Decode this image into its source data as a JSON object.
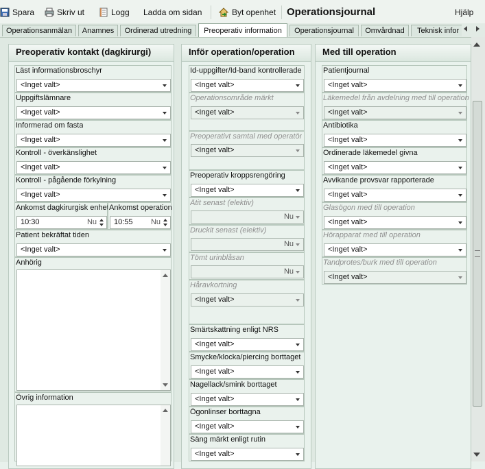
{
  "toolbar": {
    "save": "Spara",
    "print": "Skriv ut",
    "log": "Logg",
    "reload": "Ladda om sidan",
    "change_unit": "Byt openhet",
    "title": "Operationsjournal",
    "help": "Hjälp"
  },
  "tabs": [
    {
      "label": "Operationsanmälan"
    },
    {
      "label": "Anamnes"
    },
    {
      "label": "Ordinerad utredning"
    },
    {
      "label": "Preoperativ information",
      "active": true
    },
    {
      "label": "Operationsjournal"
    },
    {
      "label": "Omvårdnad"
    },
    {
      "label": "Teknisk infor"
    }
  ],
  "default_value": "<Inget valt>",
  "nu_label": "Nu",
  "panel1": {
    "header": "Preoperativ kontakt (dagkirurgi)",
    "fields": {
      "brochure": "Läst informationsbroschyr",
      "informant": "Uppgiftslämnare",
      "fasting": "Informerad om fasta",
      "allergy": "Kontroll - överkänslighet",
      "cold": "Kontroll - pågående förkylning",
      "patient_confirmed": "Patient bekräftat tiden"
    },
    "arrival_unit": {
      "label": "Ankomst dagkirurgisk enhet",
      "value": "10:30"
    },
    "arrival_op": {
      "label": "Ankomst operation",
      "value": "10:55"
    },
    "relative": "Anhörig",
    "other_info": "Övrig information"
  },
  "panel2": {
    "header": "Inför operation/operation",
    "fields": {
      "id_checked": "Id-uppgifter/Id-band kontrollerade",
      "area_marked": "Operationsområde märkt",
      "preop_talk": "Preoperativt samtal med operatör",
      "body_cleaning": "Preoperativ kroppsrengöring",
      "ate_latest": "Ätit senast (elektiv)",
      "drank_latest": "Druckit senast (elektiv)",
      "bladder": "Tömt urinblåsan",
      "hair_removal": "Håravkortning",
      "pain_nrs": "Smärtskattning enligt NRS",
      "jewelry": "Smycke/klocka/piercing borttaget",
      "nail_polish": "Nagellack/smink borttaget",
      "lenses": "Ögonlinser borttagna",
      "bed_marked": "Säng märkt enligt rutin"
    }
  },
  "panel3": {
    "header": "Med till operation",
    "fields": {
      "journal": "Patientjournal",
      "drugs_from_ward": "Läkemedel från avdelning med till operation",
      "antibiotics": "Antibiotika",
      "prescribed_given": "Ordinerade läkemedel givna",
      "deviating_tests": "Avvikande provsvar rapporterade",
      "glasses": "Glasögon med till operation",
      "hearing_aid": "Hörapparat med till operation",
      "dentures": "Tandprotes/burk med till operation"
    }
  },
  "colors": {
    "background": "#e8f1ec",
    "panel": "#e9f2ed",
    "border": "#b9c9bf"
  }
}
